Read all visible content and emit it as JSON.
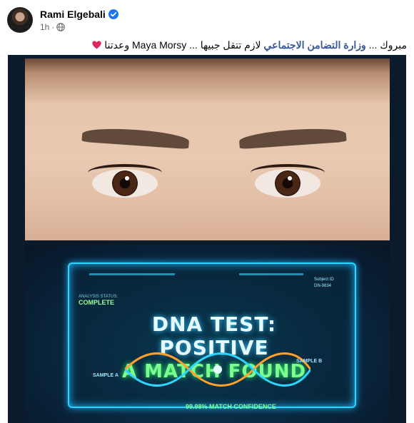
{
  "post": {
    "author": "Rami Elgebali",
    "time": "1h",
    "separator": "·",
    "caption": {
      "part1": "مبروك ... ",
      "link": "وزارة التضامن الاجتماعي",
      "part2": " لازم تتقل جبيها ... Maya Morsy وعدتنا"
    },
    "icons": {
      "verified": "verified-badge-icon",
      "privacy": "globe-icon",
      "heart": "red-heart-emoji"
    },
    "colors": {
      "author": "#050505",
      "link": "#385898",
      "meta": "#65676b",
      "verified": "#1877f2",
      "heart": "#e0245e"
    }
  },
  "image": {
    "dna_title_line1": "DNA TEST: POSITIVE",
    "dna_title_line2": "A MATCH FOUND",
    "analysis_label": "ANALYSIS STATUS:",
    "analysis_value": "COMPLETE",
    "sample_a": "SAMPLE A",
    "sample_b": "SAMPLE B",
    "subject_id": "Subject ID",
    "subject_code": "DN-9834",
    "confidence": "99.98% MATCH CONFIDENCE"
  }
}
